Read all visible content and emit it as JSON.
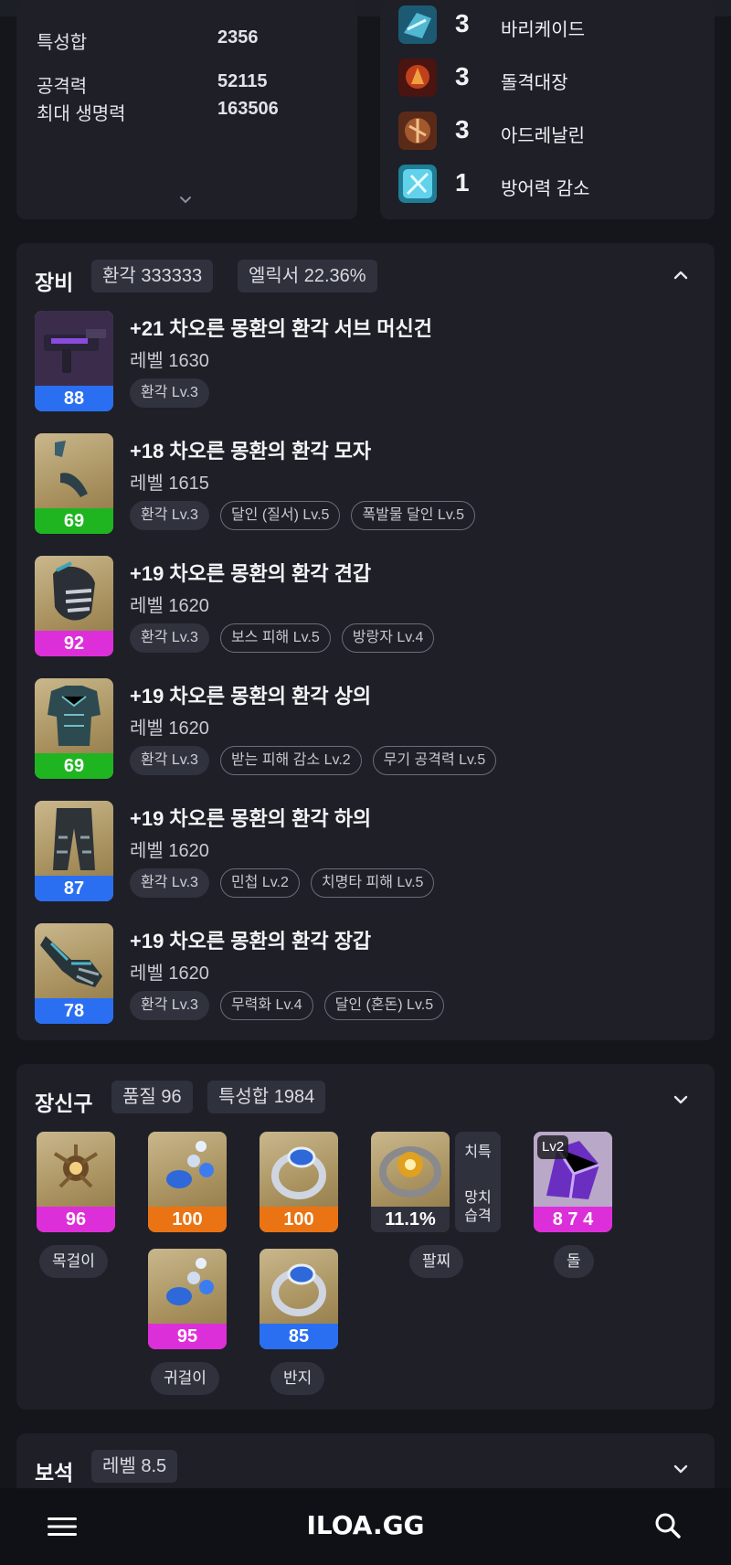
{
  "stats": {
    "rows": [
      {
        "label": "특성합",
        "value": "2356"
      },
      {
        "label": "공격력",
        "value": "52115"
      },
      {
        "label": "최대 생명력",
        "value": "163506"
      }
    ]
  },
  "engravings": [
    {
      "level": "3",
      "name": "바리케이드",
      "icon": "barricade-icon"
    },
    {
      "level": "3",
      "name": "돌격대장",
      "icon": "raid-captain-icon"
    },
    {
      "level": "3",
      "name": "아드레날린",
      "icon": "adrenaline-icon"
    },
    {
      "level": "1",
      "name": "방어력 감소",
      "icon": "defense-reduction-icon"
    }
  ],
  "equipment": {
    "title": "장비",
    "pills": [
      "환각 333333",
      "엘릭서 22.36%"
    ],
    "items": [
      {
        "name": "+21 차오른 몽환의 환각 서브 머신건",
        "level": "레벨 1630",
        "quality": "88",
        "quality_color": "#2a6ff2",
        "icon": "submachine-gun-icon",
        "tags": [
          {
            "text": "환각 Lv.3",
            "style": "filled"
          }
        ]
      },
      {
        "name": "+18 차오른 몽환의 환각 모자",
        "level": "레벨 1615",
        "quality": "69",
        "quality_color": "#1fb521",
        "icon": "hat-icon",
        "tags": [
          {
            "text": "환각 Lv.3",
            "style": "filled"
          },
          {
            "text": "달인 (질서) Lv.5",
            "style": "outline"
          },
          {
            "text": "폭발물 달인 Lv.5",
            "style": "outline"
          }
        ]
      },
      {
        "name": "+19 차오른 몽환의 환각 견갑",
        "level": "레벨 1620",
        "quality": "92",
        "quality_color": "#dd2fd9",
        "icon": "pauldron-icon",
        "tags": [
          {
            "text": "환각 Lv.3",
            "style": "filled"
          },
          {
            "text": "보스 피해 Lv.5",
            "style": "outline"
          },
          {
            "text": "방랑자 Lv.4",
            "style": "outline"
          }
        ]
      },
      {
        "name": "+19 차오른 몽환의 환각 상의",
        "level": "레벨 1620",
        "quality": "69",
        "quality_color": "#1fb521",
        "icon": "chest-armor-icon",
        "tags": [
          {
            "text": "환각 Lv.3",
            "style": "filled"
          },
          {
            "text": "받는 피해 감소 Lv.2",
            "style": "outline"
          },
          {
            "text": "무기 공격력 Lv.5",
            "style": "outline"
          }
        ]
      },
      {
        "name": "+19 차오른 몽환의 환각 하의",
        "level": "레벨 1620",
        "quality": "87",
        "quality_color": "#2a6ff2",
        "icon": "pants-icon",
        "tags": [
          {
            "text": "환각 Lv.3",
            "style": "filled"
          },
          {
            "text": "민첩 Lv.2",
            "style": "outline"
          },
          {
            "text": "치명타 피해 Lv.5",
            "style": "outline"
          }
        ]
      },
      {
        "name": "+19 차오른 몽환의 환각 장갑",
        "level": "레벨 1620",
        "quality": "78",
        "quality_color": "#2a6ff2",
        "icon": "gloves-icon",
        "tags": [
          {
            "text": "환각 Lv.3",
            "style": "filled"
          },
          {
            "text": "무력화 Lv.4",
            "style": "outline"
          },
          {
            "text": "달인 (혼돈) Lv.5",
            "style": "outline"
          }
        ]
      }
    ]
  },
  "accessories": {
    "title": "장신구",
    "pills": [
      "품질 96",
      "특성합 1984"
    ],
    "necklace": {
      "quality": "96",
      "color": "#dd2fd9",
      "label": "목걸이",
      "icon": "necklace-icon"
    },
    "earring1": {
      "quality": "100",
      "color": "#ea7414",
      "icon": "earring-icon"
    },
    "earring2": {
      "quality": "95",
      "color": "#dd2fd9",
      "label": "귀걸이",
      "icon": "earring-icon"
    },
    "ring1": {
      "quality": "100",
      "color": "#ea7414",
      "icon": "ring-icon"
    },
    "ring2": {
      "quality": "85",
      "color": "#2a6ff2",
      "label": "반지",
      "icon": "ring-icon"
    },
    "bracelet": {
      "value": "11.1%",
      "label": "팔찌",
      "stat1": "치특",
      "stat2a": "망치",
      "stat2b": "습격",
      "icon": "bracelet-icon"
    },
    "stone": {
      "lv": "Lv2",
      "value": "8 7 4",
      "color": "#dd2fd9",
      "label": "돌",
      "icon": "ability-stone-icon"
    }
  },
  "gems": {
    "title": "보석",
    "pill": "레벨 8.5"
  },
  "nav": {
    "logo": "ILOA.GG",
    "menu_icon": "hamburger-menu-icon",
    "search_icon": "search-icon"
  }
}
